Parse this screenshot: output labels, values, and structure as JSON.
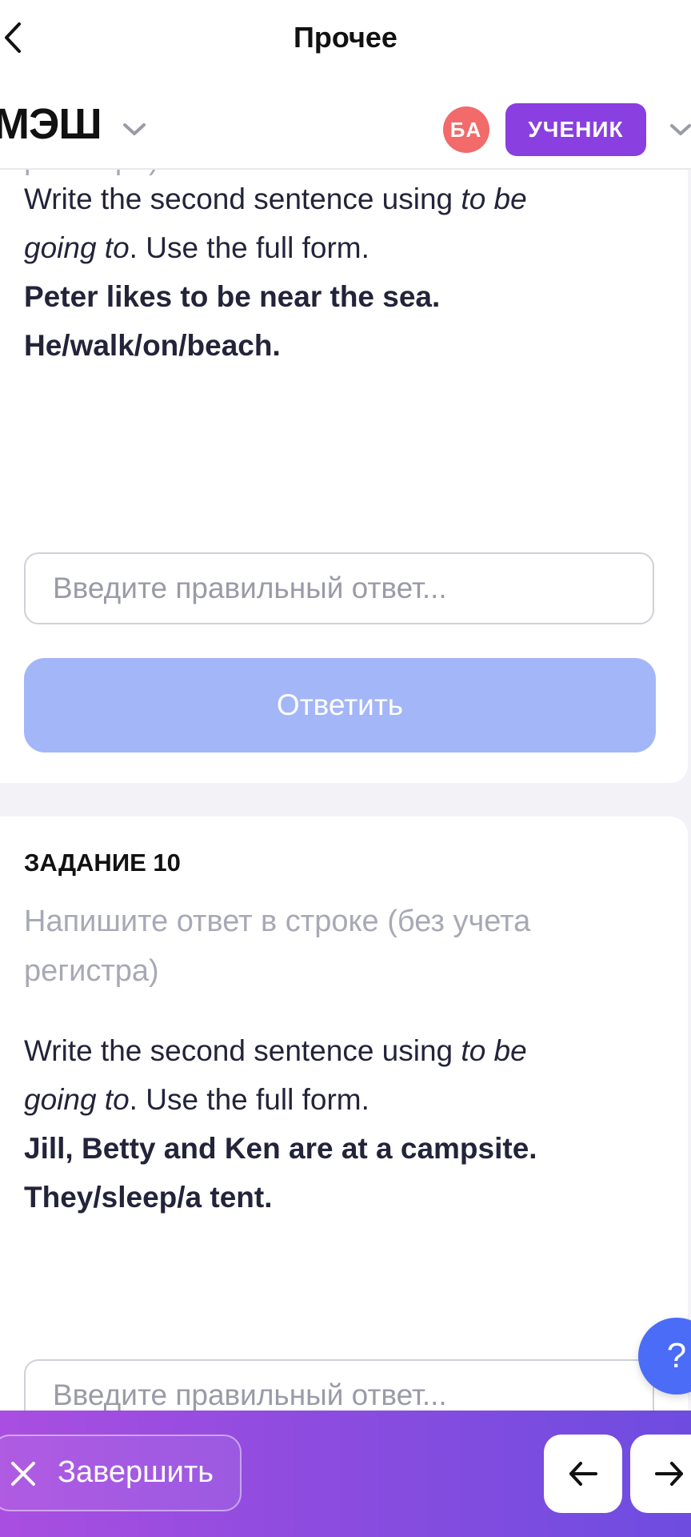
{
  "navbar": {
    "title": "Прочее"
  },
  "app_header": {
    "brand": "МЭШ",
    "avatar_initials": "БА",
    "role": "УЧЕНИК"
  },
  "task9": {
    "hint_tail": "регистра)",
    "instruction_start": "Write the second sentence using ",
    "instruction_italic": "to be going to",
    "instruction_end": ". Use the full form.",
    "sentence1": "Peter likes to be near the sea.",
    "sentence2": "He/walk/on/beach.",
    "input_placeholder": "Введите правильный ответ...",
    "submit_label": "Ответить"
  },
  "task10": {
    "heading": "ЗАДАНИЕ 10",
    "hint": "Напишите ответ в строке (без учета регистра)",
    "instruction_start": "Write the second sentence using ",
    "instruction_italic": "to be going to",
    "instruction_end": ". Use the full form.",
    "sentence1": "Jill, Betty and Ken are at a campsite.",
    "sentence2": "They/sleep/a tent.",
    "input_placeholder": "Введите правильный ответ..."
  },
  "help_button": {
    "label": "?"
  },
  "bottom_bar": {
    "finish_label": "Завершить"
  },
  "colors": {
    "accent_purple": "#8a3fe0",
    "avatar_red": "#f26a6a",
    "submit_disabled": "#a3b6f8",
    "help_blue": "#4a6cf7"
  }
}
